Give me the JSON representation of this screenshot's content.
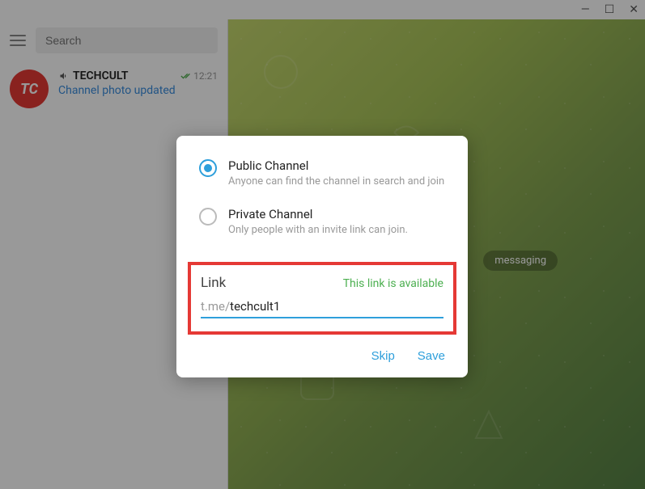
{
  "window": {
    "min": "—",
    "max": "☐",
    "close": "✕"
  },
  "sidebar": {
    "search_placeholder": "Search",
    "chat": {
      "avatar_text": "TC",
      "name": "TECHCULT",
      "time": "12:21",
      "message": "Channel photo updated"
    }
  },
  "main": {
    "badge_text": "messaging"
  },
  "modal": {
    "options": {
      "public": {
        "title": "Public Channel",
        "desc": "Anyone can find the channel in search and join"
      },
      "private": {
        "title": "Private Channel",
        "desc": "Only people with an invite link can join."
      }
    },
    "link": {
      "label": "Link",
      "status": "This link is available",
      "prefix": "t.me/",
      "value": "techcult1"
    },
    "actions": {
      "skip": "Skip",
      "save": "Save"
    }
  }
}
